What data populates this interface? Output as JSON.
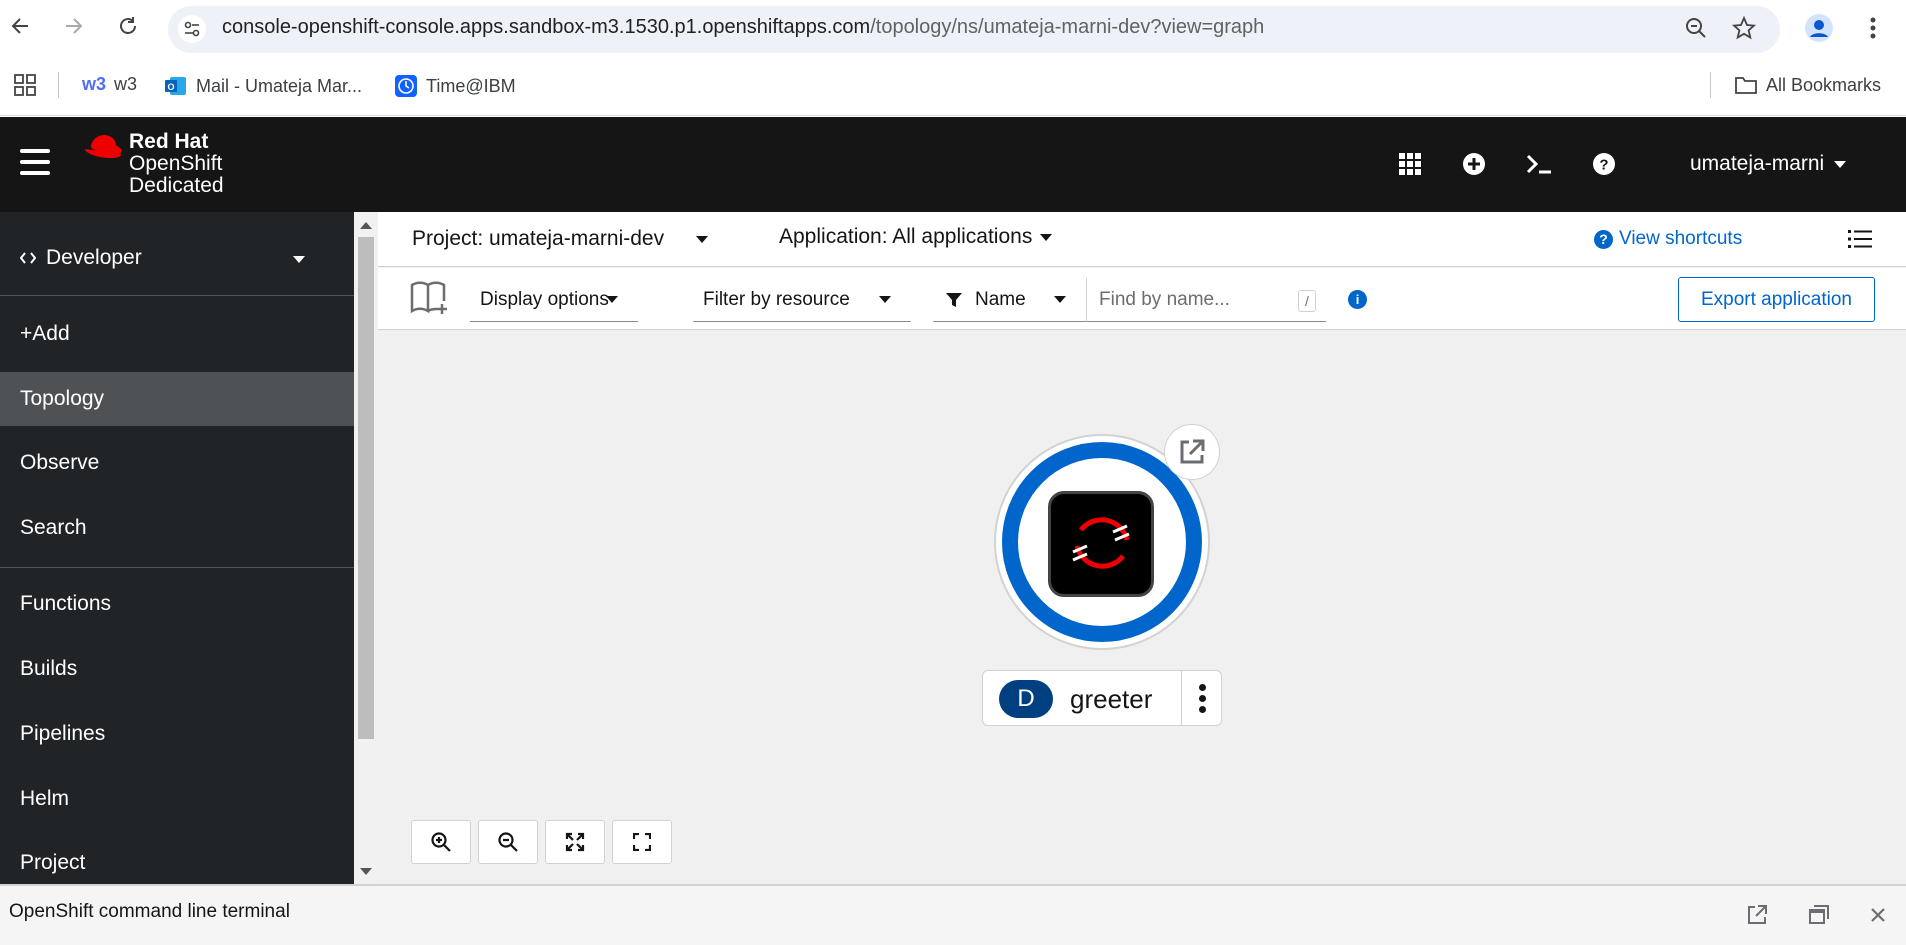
{
  "browser": {
    "url_domain": "console-openshift-console.apps.sandbox-m3.1530.p1.openshiftapps.com",
    "url_path": "/topology/ns/umateja-marni-dev?view=graph",
    "bookmarks": [
      {
        "label": "w3",
        "icon_text": "w3"
      },
      {
        "label": "Mail - Umateja Mar..."
      },
      {
        "label": "Time@IBM"
      }
    ],
    "all_bookmarks_label": "All Bookmarks"
  },
  "masthead": {
    "brand": "Red Hat",
    "product_line1": "OpenShift",
    "product_line2": "Dedicated",
    "user": "umateja-marni"
  },
  "sidebar": {
    "perspective": "Developer",
    "items": [
      {
        "label": "+Add"
      },
      {
        "label": "Topology"
      },
      {
        "label": "Observe"
      },
      {
        "label": "Search"
      },
      {
        "label": "Functions"
      },
      {
        "label": "Builds"
      },
      {
        "label": "Pipelines"
      },
      {
        "label": "Helm"
      },
      {
        "label": "Project"
      }
    ]
  },
  "main": {
    "project_label": "Project: umateja-marni-dev",
    "application_label": "Application: All applications",
    "view_shortcuts": "View shortcuts",
    "toolbar": {
      "display_options": "Display options",
      "filter_by_resource": "Filter by resource",
      "filter_type": "Name",
      "search_placeholder": "Find by name...",
      "slash_hint": "/",
      "export_label": "Export application"
    },
    "node": {
      "badge": "D",
      "name": "greeter"
    }
  },
  "terminal": {
    "title": "OpenShift command line terminal"
  },
  "colors": {
    "accent": "#0066cc",
    "masthead": "#151515",
    "sidebar": "#212427",
    "redhat_red": "#ee0000"
  }
}
